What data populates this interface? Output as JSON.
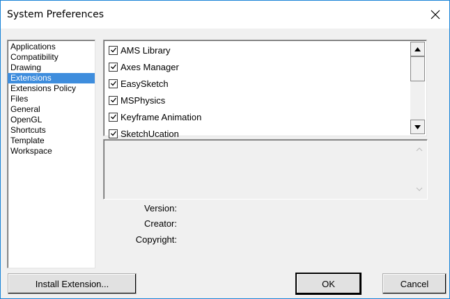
{
  "window": {
    "title": "System Preferences"
  },
  "categories": [
    {
      "label": "Applications",
      "selected": false
    },
    {
      "label": "Compatibility",
      "selected": false
    },
    {
      "label": "Drawing",
      "selected": false
    },
    {
      "label": "Extensions",
      "selected": true
    },
    {
      "label": "Extensions Policy",
      "selected": false
    },
    {
      "label": "Files",
      "selected": false
    },
    {
      "label": "General",
      "selected": false
    },
    {
      "label": "OpenGL",
      "selected": false
    },
    {
      "label": "Shortcuts",
      "selected": false
    },
    {
      "label": "Template",
      "selected": false
    },
    {
      "label": "Workspace",
      "selected": false
    }
  ],
  "extensions": [
    {
      "label": "AMS Library",
      "checked": true
    },
    {
      "label": "Axes Manager",
      "checked": true
    },
    {
      "label": "EasySketch",
      "checked": true
    },
    {
      "label": "MSPhysics",
      "checked": true
    },
    {
      "label": "Keyframe Animation",
      "checked": true
    },
    {
      "label": "SketchUcation",
      "checked": true
    }
  ],
  "details": {
    "version_label": "Version:",
    "creator_label": "Creator:",
    "copyright_label": "Copyright:"
  },
  "buttons": {
    "install": "Install Extension...",
    "ok": "OK",
    "cancel": "Cancel"
  },
  "colors": {
    "selection": "#3e8ddd",
    "window_border": "#1883d7"
  }
}
